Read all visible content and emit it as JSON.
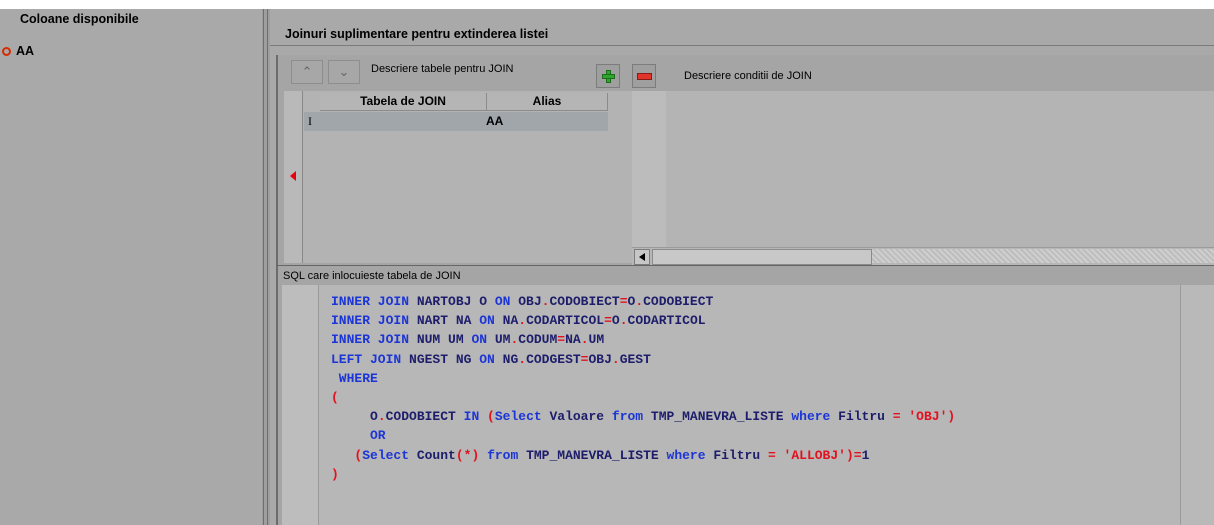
{
  "left_panel": {
    "title": "Coloane disponibile",
    "items": [
      {
        "label": "AA"
      }
    ]
  },
  "right_panel": {
    "title": "Joinuri suplimentare pentru extinderea listei"
  },
  "join_toolbar": {
    "tables_label": "Descriere tabele pentru JOIN",
    "conditions_label": "Descriere conditii de JOIN",
    "up_icon": "chevron-up-icon",
    "down_icon": "chevron-down-icon",
    "add_icon": "plus-icon",
    "remove_icon": "minus-icon"
  },
  "join_grid": {
    "columns": [
      "Tabela de JOIN",
      "Alias"
    ],
    "rows": [
      {
        "cursor": "I",
        "table": "",
        "alias": "AA"
      }
    ]
  },
  "sql": {
    "label": "SQL care inlocuieste tabela de JOIN",
    "lines": [
      [
        [
          "k",
          "INNER JOIN "
        ],
        [
          "t",
          "NARTOBJ O "
        ],
        [
          "k",
          "ON "
        ],
        [
          "t",
          "OBJ"
        ],
        [
          "o",
          "."
        ],
        [
          "t",
          "CODOBIECT"
        ],
        [
          "o",
          "="
        ],
        [
          "t",
          "O"
        ],
        [
          "o",
          "."
        ],
        [
          "t",
          "CODOBIECT"
        ]
      ],
      [
        [
          "k",
          "INNER JOIN "
        ],
        [
          "t",
          "NART NA "
        ],
        [
          "k",
          "ON "
        ],
        [
          "t",
          "NA"
        ],
        [
          "o",
          "."
        ],
        [
          "t",
          "CODARTICOL"
        ],
        [
          "o",
          "="
        ],
        [
          "t",
          "O"
        ],
        [
          "o",
          "."
        ],
        [
          "t",
          "CODARTICOL"
        ]
      ],
      [
        [
          "k",
          "INNER JOIN "
        ],
        [
          "t",
          "NUM UM "
        ],
        [
          "k",
          "ON "
        ],
        [
          "t",
          "UM"
        ],
        [
          "o",
          "."
        ],
        [
          "t",
          "CODUM"
        ],
        [
          "o",
          "="
        ],
        [
          "t",
          "NA"
        ],
        [
          "o",
          "."
        ],
        [
          "t",
          "UM"
        ]
      ],
      [
        [
          "k",
          "LEFT JOIN "
        ],
        [
          "t",
          "NGEST NG "
        ],
        [
          "k",
          "ON "
        ],
        [
          "t",
          "NG"
        ],
        [
          "o",
          "."
        ],
        [
          "t",
          "CODGEST"
        ],
        [
          "o",
          "="
        ],
        [
          "t",
          "OBJ"
        ],
        [
          "o",
          "."
        ],
        [
          "t",
          "GEST"
        ]
      ],
      [
        [
          "k",
          " WHERE"
        ]
      ],
      [
        [
          "o",
          "("
        ]
      ],
      [
        [
          "t",
          "     O"
        ],
        [
          "o",
          "."
        ],
        [
          "t",
          "CODOBIECT "
        ],
        [
          "k",
          "IN "
        ],
        [
          "o",
          "("
        ],
        [
          "k",
          "Select "
        ],
        [
          "t",
          "Valoare "
        ],
        [
          "k",
          "from "
        ],
        [
          "t",
          "TMP_MANEVRA_LISTE "
        ],
        [
          "k",
          "where "
        ],
        [
          "t",
          "Filtru "
        ],
        [
          "o",
          "= "
        ],
        [
          "s",
          "'OBJ'"
        ],
        [
          "o",
          ")"
        ]
      ],
      [
        [
          "k",
          "     OR"
        ]
      ],
      [
        [
          "t",
          "   "
        ],
        [
          "o",
          "("
        ],
        [
          "k",
          "Select "
        ],
        [
          "t",
          "Count"
        ],
        [
          "o",
          "(*) "
        ],
        [
          "k",
          "from "
        ],
        [
          "t",
          "TMP_MANEVRA_LISTE "
        ],
        [
          "k",
          "where "
        ],
        [
          "t",
          "Filtru "
        ],
        [
          "o",
          "= "
        ],
        [
          "s",
          "'ALLOBJ'"
        ],
        [
          "o",
          ")="
        ],
        [
          "t",
          "1"
        ]
      ],
      [
        [
          "o",
          ")"
        ]
      ]
    ]
  }
}
